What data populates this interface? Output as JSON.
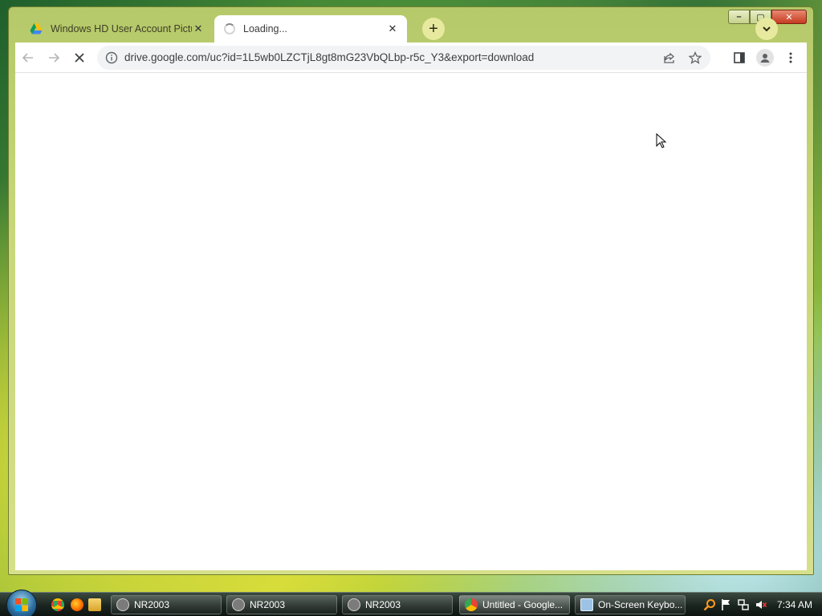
{
  "window": {
    "controls": {
      "minimize": "–",
      "maximize": "▢",
      "close": "✕"
    }
  },
  "tabs": [
    {
      "title": "Windows HD User Account Pictu",
      "close": "✕",
      "icon": "google-drive-icon",
      "state": "inactive"
    },
    {
      "title": "Loading...",
      "close": "✕",
      "icon": "loading-spinner-icon",
      "state": "active"
    }
  ],
  "toolbar": {
    "url": "drive.google.com/uc?id=1L5wb0LZCTjL8gt8mG23VbQLbp-r5c_Y3&export=download",
    "new_tab": "+",
    "icons": [
      "back-icon",
      "forward-icon",
      "stop-icon",
      "site-info-icon",
      "share-icon",
      "bookmark-star-icon",
      "side-panel-icon",
      "profile-icon",
      "menu-icon"
    ]
  },
  "taskbar": {
    "buttons": [
      {
        "label": "NR2003",
        "icon": "nr2003-icon"
      },
      {
        "label": "NR2003",
        "icon": "nr2003-icon"
      },
      {
        "label": "NR2003",
        "icon": "nr2003-icon"
      },
      {
        "label": "Untitled - Google...",
        "icon": "chrome-icon",
        "active": true
      },
      {
        "label": "On-Screen Keybo...",
        "icon": "keyboard-icon"
      }
    ],
    "quick_launch": [
      "chrome-icon",
      "firefox-icon",
      "folder-icon"
    ],
    "tray_icons": [
      "search-icon",
      "flag-icon",
      "network-icon",
      "volume-muted-icon"
    ],
    "clock": "7:34 AM"
  },
  "colors": {
    "tab_strip_tint": "#c8d77a",
    "active_tab": "#ffffff",
    "new_tab_button": "#e7ea9e",
    "close_button": "#c43b22"
  }
}
